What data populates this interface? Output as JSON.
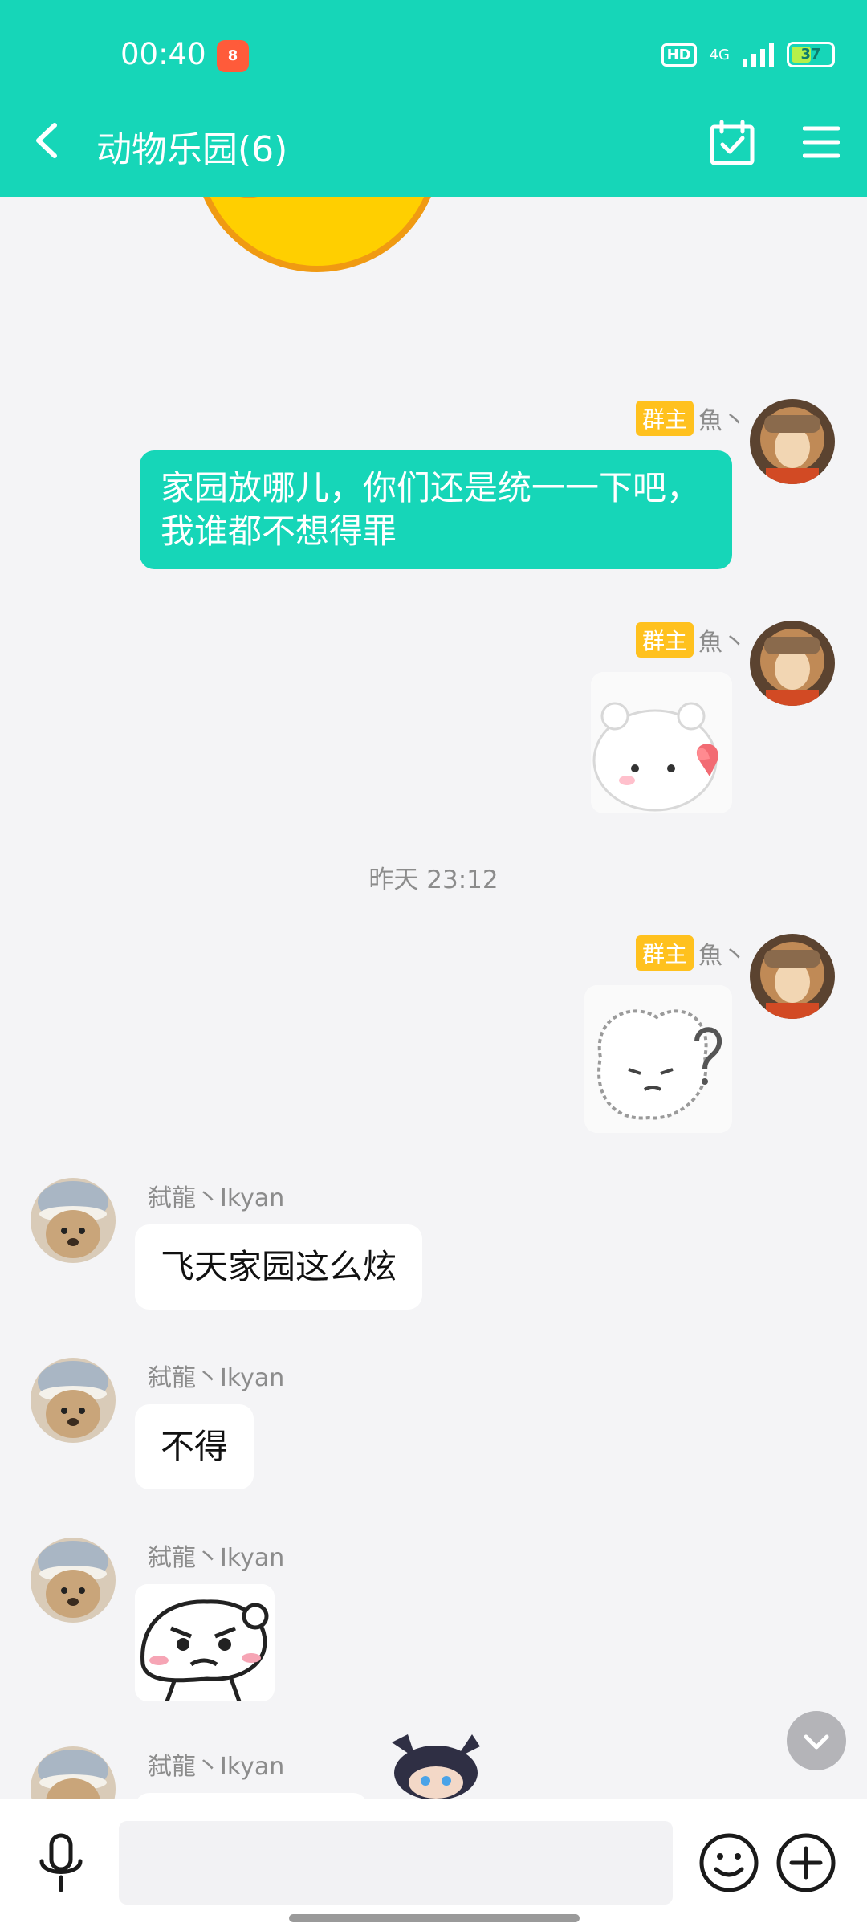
{
  "status": {
    "time": "00:40",
    "hd": "HD",
    "network": "4G",
    "battery": "37"
  },
  "header": {
    "title": "动物乐园(6)"
  },
  "messages": [
    {
      "sender": "魚丶",
      "role": "群主",
      "text": "家园放哪儿，你们还是统一一下吧，我谁都不想得罪"
    },
    {
      "sender": "魚丶",
      "role": "群主",
      "sticker": "white-bear-heart-sticker"
    },
    {
      "divider": "昨天 23:12"
    },
    {
      "sender": "魚丶",
      "role": "群主",
      "sticker": "bear-question-sticker"
    },
    {
      "sender": "弑龍丶Ikyan",
      "text": "飞天家园这么炫"
    },
    {
      "sender": "弑龍丶Ikyan",
      "text": "不得"
    },
    {
      "sender": "弑龍丶Ikyan",
      "sticker": "angry-blob-sticker"
    },
    {
      "sender": "弑龍丶Ikyan"
    }
  ],
  "colors": {
    "accent": "#16d6b8",
    "badge": "#ffc11e",
    "background": "#f4f4f6"
  },
  "icons": [
    "back-icon",
    "calendar-check-icon",
    "menu-icon",
    "chevron-down-icon",
    "mic-icon",
    "emoji-icon",
    "plus-icon"
  ]
}
